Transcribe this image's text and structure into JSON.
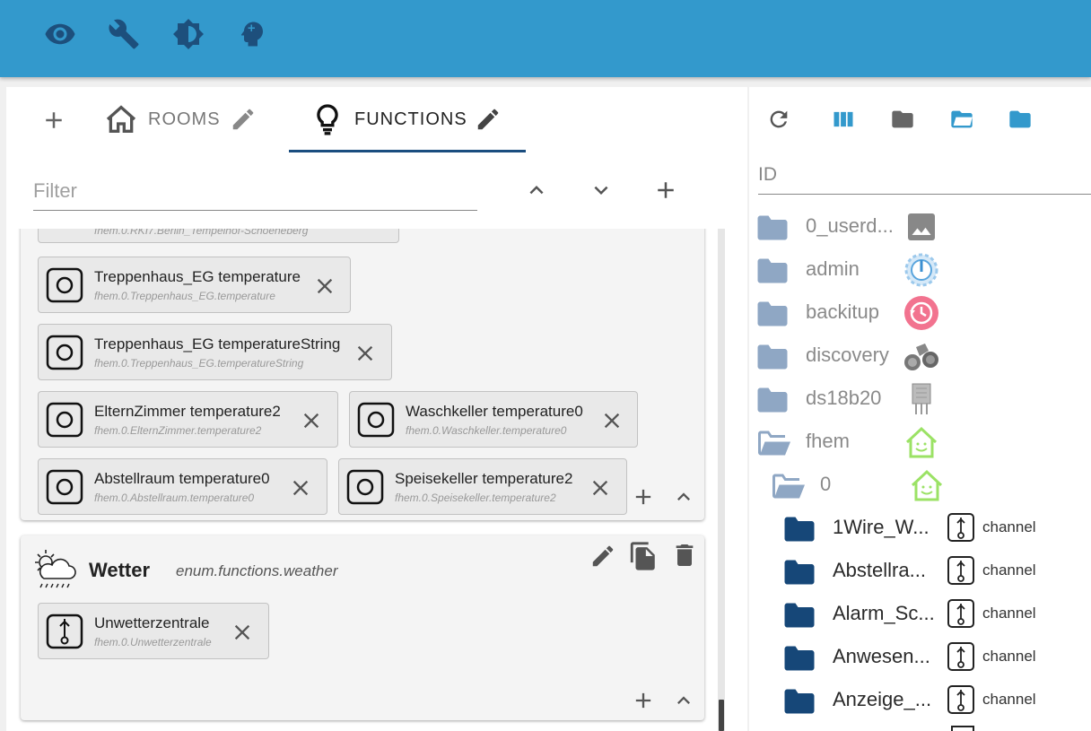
{
  "toolbar": {
    "icons": [
      "eye-icon",
      "wrench-icon",
      "brightness-icon",
      "head-icon"
    ]
  },
  "tabs": [
    {
      "label": "ROOMS",
      "icon": "home-icon",
      "active": false
    },
    {
      "label": "FUNCTIONS",
      "icon": "lightbulb-icon",
      "active": true
    }
  ],
  "filter": {
    "placeholder": "Filter",
    "value": ""
  },
  "card1": {
    "chips": [
      {
        "title": "",
        "id": "fhem.0.RKI7.Berlin_Tempelhof-Schoeneberg"
      },
      {
        "title": "Treppenhaus_EG temperature",
        "id": "fhem.0.Treppenhaus_EG.temperature"
      },
      {
        "title": "Treppenhaus_EG temperatureString",
        "id": "fhem.0.Treppenhaus_EG.temperatureString"
      },
      {
        "title": "ElternZimmer temperature2",
        "id": "fhem.0.ElternZimmer.temperature2"
      },
      {
        "title": "Waschkeller temperature0",
        "id": "fhem.0.Waschkeller.temperature0"
      },
      {
        "title": "Abstellraum temperature0",
        "id": "fhem.0.Abstellraum.temperature0"
      },
      {
        "title": "Speisekeller temperature2",
        "id": "fhem.0.Speisekeller.temperature2"
      }
    ]
  },
  "card2": {
    "title": "Wetter",
    "enum_id": "enum.functions.weather",
    "chips": [
      {
        "title": "Unwetterzentrale",
        "id": "fhem.0.Unwetterzentrale"
      }
    ]
  },
  "objects": {
    "column_header": "ID",
    "rows": [
      {
        "label": "0_userd...",
        "role": ""
      },
      {
        "label": "admin",
        "role": ""
      },
      {
        "label": "backitup",
        "role": ""
      },
      {
        "label": "discovery",
        "role": ""
      },
      {
        "label": "ds18b20",
        "role": ""
      },
      {
        "label": "fhem",
        "role": ""
      },
      {
        "label": "0",
        "role": ""
      },
      {
        "label": "1Wire_W...",
        "role": "channel"
      },
      {
        "label": "Abstellra...",
        "role": "channel"
      },
      {
        "label": "Alarm_Sc...",
        "role": "channel"
      },
      {
        "label": "Anwesen...",
        "role": "channel"
      },
      {
        "label": "Anzeige_...",
        "role": "channel"
      }
    ]
  },
  "colors": {
    "appbar": "#3399cc",
    "tab_indicator": "#1a4d7f",
    "folder_grey": "#8fa7c4",
    "folder_dark": "#164778",
    "toolbar_blue": "#3399cc"
  }
}
